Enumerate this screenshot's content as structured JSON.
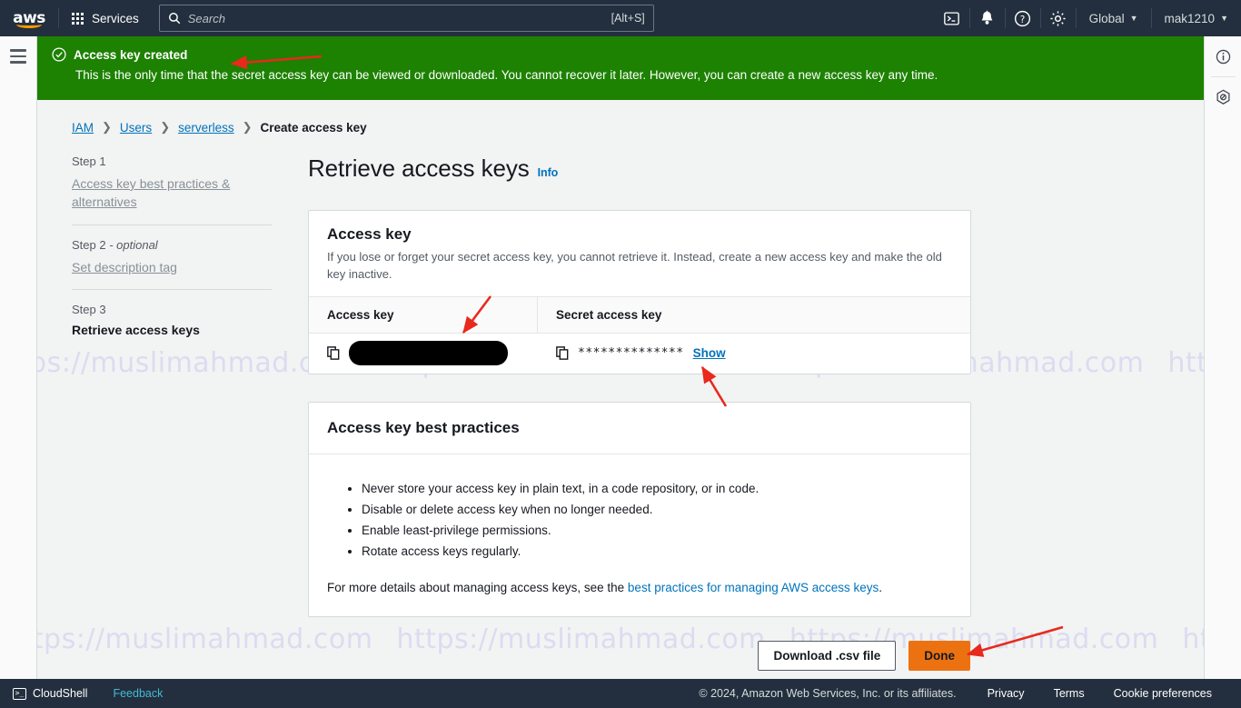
{
  "topnav": {
    "logo_text": "aws",
    "services_label": "Services",
    "search_placeholder": "Search",
    "search_value": "",
    "search_shortcut": "[Alt+S]",
    "cloudshell_icon": "terminal-icon",
    "notifications_icon": "bell-icon",
    "help_icon": "question-circle-icon",
    "settings_icon": "gear-icon",
    "region_label": "Global",
    "account_label": "mak1210",
    "caret": "▼"
  },
  "right_rail": {
    "info_icon": "info-circle-icon",
    "shortcut_icon": "no-entry-icon"
  },
  "banner": {
    "icon": "check-circle-icon",
    "title": "Access key created",
    "message": "This is the only time that the secret access key can be viewed or downloaded. You cannot recover it later. However, you can create a new access key any time.",
    "color": "#1d8102"
  },
  "breadcrumb": [
    {
      "label": "IAM",
      "link": true
    },
    {
      "label": "Users",
      "link": true
    },
    {
      "label": "serverless",
      "link": true
    },
    {
      "label": "Create access key",
      "link": false
    }
  ],
  "breadcrumb_separator": "❯",
  "steps": [
    {
      "number": "Step 1",
      "optional": "",
      "label": "Access key best practices & alternatives",
      "current": false
    },
    {
      "number": "Step 2",
      "optional": " - optional",
      "label": "Set description tag",
      "current": false
    },
    {
      "number": "Step 3",
      "optional": "",
      "label": "Retrieve access keys",
      "current": true
    }
  ],
  "page": {
    "title": "Retrieve access keys",
    "info_label": "Info"
  },
  "access_key_card": {
    "title": "Access key",
    "description": "If you lose or forget your secret access key, you cannot retrieve it. Instead, create a new access key and make the old key inactive.",
    "columns": [
      "Access key",
      "Secret access key"
    ],
    "access_key_value": "",
    "access_key_redacted": true,
    "secret_masked": "**************",
    "show_label": "Show",
    "copy_icon": "copy-icon"
  },
  "best_practices_card": {
    "title": "Access key best practices",
    "items": [
      "Never store your access key in plain text, in a code repository, or in code.",
      "Disable or delete access key when no longer needed.",
      "Enable least-privilege permissions.",
      "Rotate access keys regularly."
    ],
    "note_prefix": "For more details about managing access keys, see the ",
    "note_link": "best practices for managing AWS access keys",
    "note_suffix": "."
  },
  "actions": {
    "download_label": "Download .csv file",
    "done_label": "Done",
    "done_color": "#ec7211"
  },
  "footer": {
    "cloudshell_label": "CloudShell",
    "feedback_label": "Feedback",
    "copyright": "© 2024, Amazon Web Services, Inc. or its affiliates.",
    "links": [
      "Privacy",
      "Terms",
      "Cookie preferences"
    ]
  },
  "watermark": {
    "text": "https://muslimahmad.com",
    "color": "#d8d8f0"
  }
}
